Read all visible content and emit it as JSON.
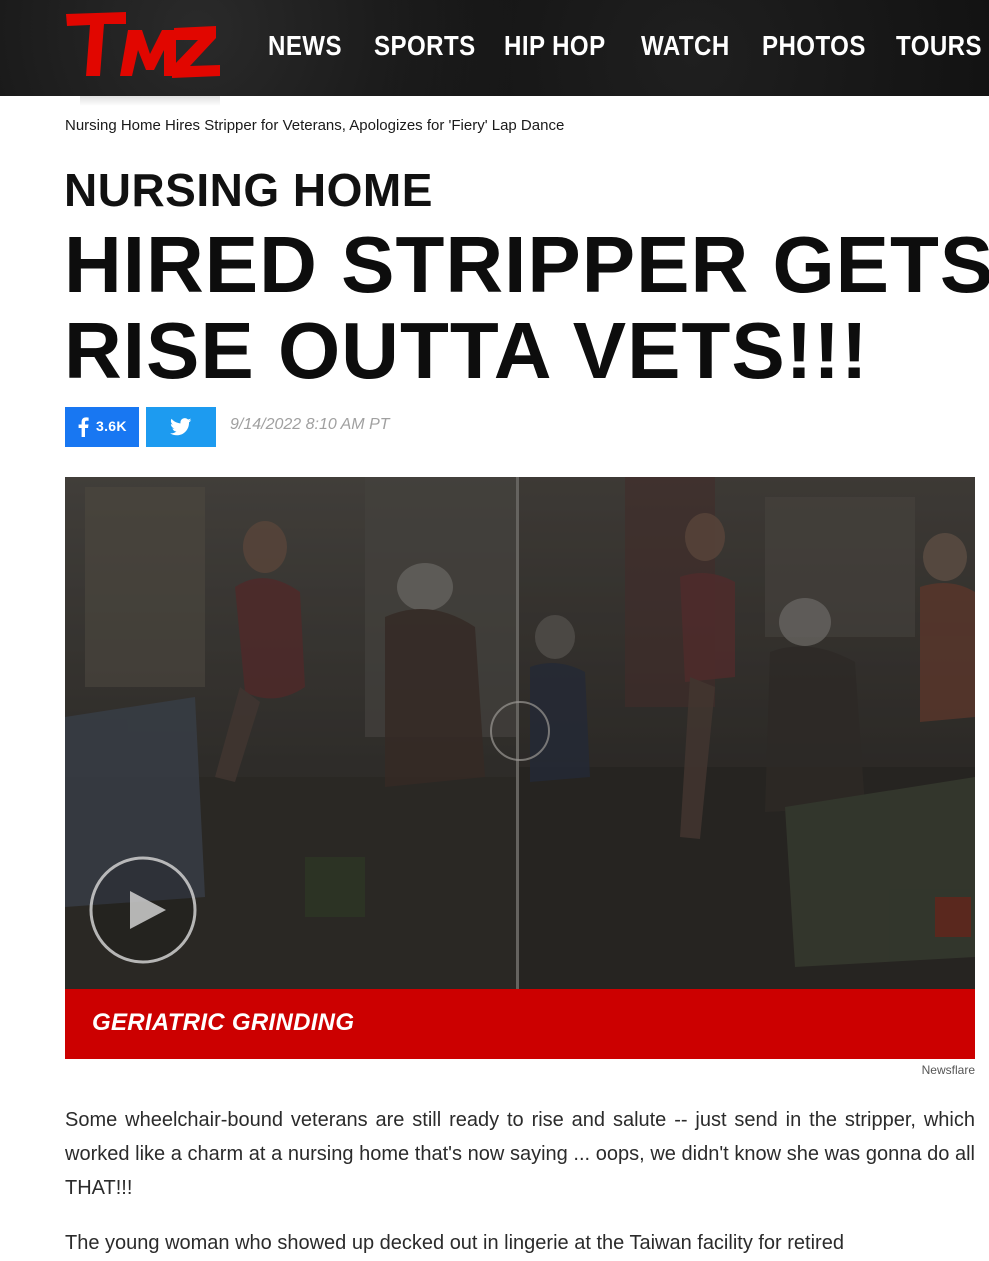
{
  "header": {
    "logo_text": "TMZ",
    "brand_color": "#e10600",
    "nav": [
      "NEWS",
      "SPORTS",
      "HIP HOP",
      "WATCH",
      "PHOTOS",
      "TOURS"
    ]
  },
  "breadcrumb": "Nursing Home Hires Stripper for Veterans, Apologizes for 'Fiery' Lap Dance",
  "article": {
    "kicker": "NURSING HOME",
    "headline_line1": "HIRED STRIPPER GETS",
    "headline_line2": "RISE OUTTA VETS!!!",
    "facebook_count": "3.6K",
    "timestamp": "9/14/2022 8:10 AM PT"
  },
  "video": {
    "caption": "GERIATRIC GRINDING",
    "credit": "Newsflare",
    "play_icon": "play-icon"
  },
  "body": {
    "p1": "Some wheelchair-bound veterans are still ready to rise and salute -- just send in the stripper, which worked like a charm at a nursing home that's now saying ... oops, we didn't know she was gonna do all THAT!!!",
    "p2": "The young woman who showed up decked out in lingerie at the Taiwan facility for retired"
  },
  "colors": {
    "facebook": "#1877f2",
    "twitter": "#1d9bf0",
    "caption_bar": "#cc0000"
  }
}
